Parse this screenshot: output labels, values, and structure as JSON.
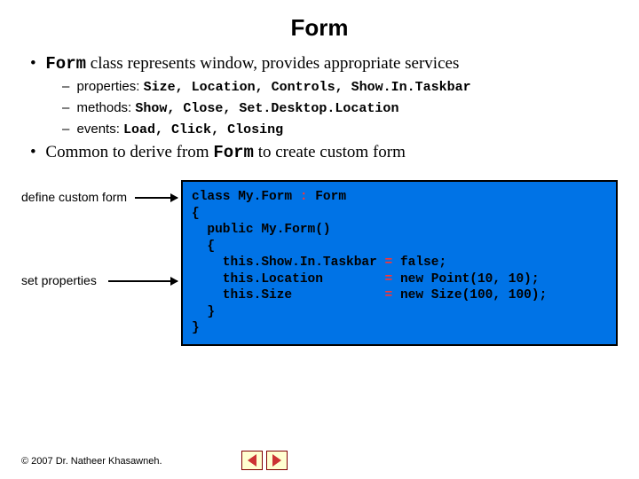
{
  "title": "Form",
  "b1": {
    "pre": "Form",
    "post": " class represents window, provides appropriate services",
    "sub": [
      {
        "label": "properties: ",
        "code": "Size, Location, Controls, Show.In.Taskbar"
      },
      {
        "label": "methods: ",
        "code": "Show, Close, Set.Desktop.Location"
      },
      {
        "label": "events: ",
        "code": "Load, Click, Closing"
      }
    ]
  },
  "b2": {
    "pre": "Common to derive from ",
    "code": "Form",
    "post": " to create custom form"
  },
  "annot": {
    "define": "define custom form",
    "setprops": "set properties"
  },
  "code": {
    "l1a": "class My.Form ",
    "l1op": ":",
    "l1b": " Form",
    "l2": "{",
    "l3": "  public My.Form()",
    "l4": "  {",
    "l5a": "    this.Show.In.Taskbar ",
    "l5op": "=",
    "l5b": " false;",
    "l6a": "    this.Location        ",
    "l6op": "=",
    "l6b": " new Point(10, 10);",
    "l7a": "    this.Size            ",
    "l7op": "=",
    "l7b": " new Size(100, 100);",
    "l8": "  }",
    "l9": "}"
  },
  "footer": "© 2007 Dr. Natheer Khasawneh."
}
